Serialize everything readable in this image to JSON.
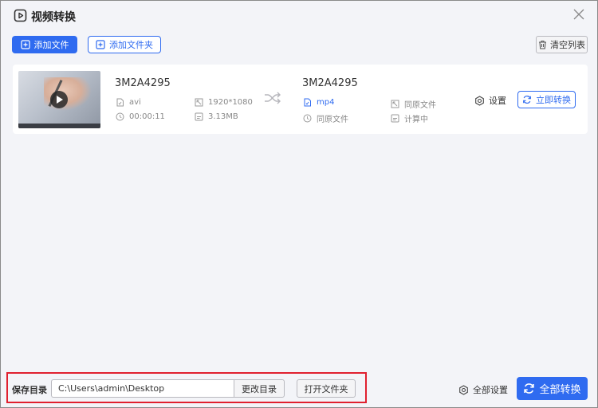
{
  "window": {
    "title": "视频转换"
  },
  "toolbar": {
    "add_file": "添加文件",
    "add_folder": "添加文件夹",
    "clear_list": "清空列表"
  },
  "file": {
    "source": {
      "name": "3M2A4295",
      "format": "avi",
      "resolution": "1920*1080",
      "duration": "00:00:11",
      "size": "3.13MB"
    },
    "output": {
      "name": "3M2A4295",
      "format": "mp4",
      "resolution": "同原文件",
      "duration": "同原文件",
      "size": "计算中"
    },
    "settings_label": "设置",
    "convert_now": "立即转换"
  },
  "footer": {
    "save_dir_label": "保存目录",
    "save_path": "C:\\Users\\admin\\Desktop",
    "change_dir": "更改目录",
    "open_folder": "打开文件夹",
    "all_settings": "全部设置",
    "convert_all": "全部转换"
  },
  "colors": {
    "accent": "#2f6bf0",
    "highlight": "#e0202f"
  }
}
